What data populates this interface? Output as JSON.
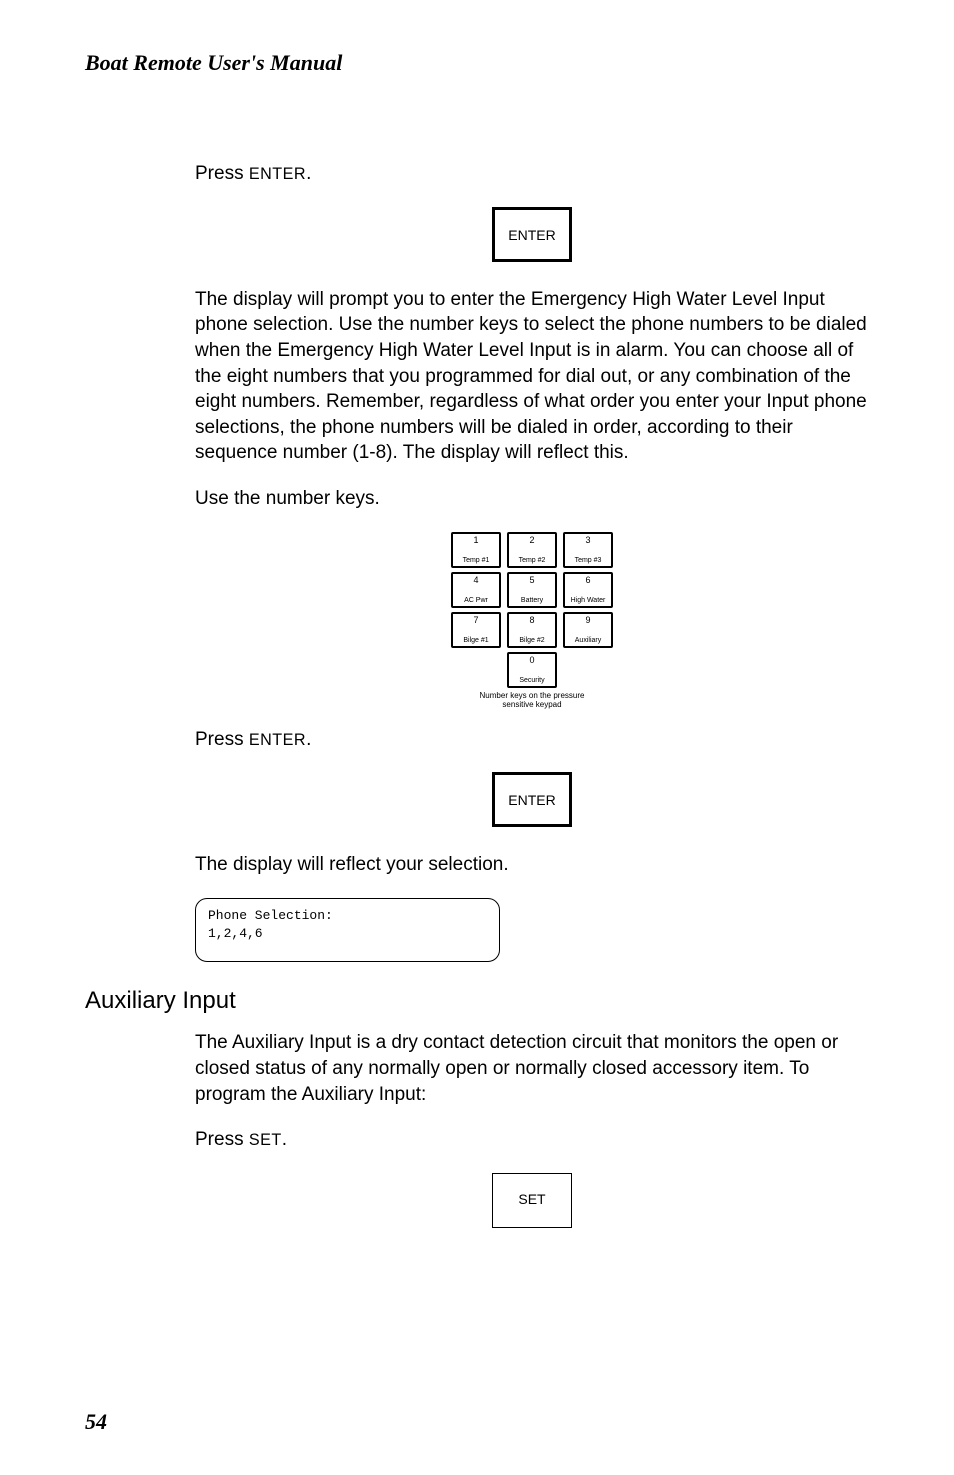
{
  "header": "Boat Remote User's Manual",
  "p1": "Press ",
  "p1_key": "ENTER",
  "p1_suffix": ".",
  "btn_enter": "ENTER",
  "p2": "The display will prompt you to enter the Emergency High Water Level Input phone selection. Use the number keys to select the phone numbers to be dialed when the Emergency High Water Level Input is in alarm. You can choose all of the eight numbers that you programmed for dial out, or any combination of the eight numbers. Remember, regardless of what order you enter your Input phone selections, the phone numbers will be dialed in order, according to their sequence number (1-8). The display will reflect this.",
  "p3": "Use the number keys.",
  "keypad": {
    "rows": [
      [
        {
          "num": "1",
          "lbl": "Temp #1"
        },
        {
          "num": "2",
          "lbl": "Temp #2"
        },
        {
          "num": "3",
          "lbl": "Temp #3"
        }
      ],
      [
        {
          "num": "4",
          "lbl": "AC Pwr"
        },
        {
          "num": "5",
          "lbl": "Battery"
        },
        {
          "num": "6",
          "lbl": "High\nWater"
        }
      ],
      [
        {
          "num": "7",
          "lbl": "Bilge #1"
        },
        {
          "num": "8",
          "lbl": "Bilge #2"
        },
        {
          "num": "9",
          "lbl": "Auxiliary"
        }
      ],
      [
        {
          "num": "0",
          "lbl": "Security"
        }
      ]
    ],
    "caption_line1": "Number keys on the pressure",
    "caption_line2": "sensitive keypad"
  },
  "p4": "Press ",
  "p4_key": "ENTER",
  "p4_suffix": ".",
  "p5": "The display will reflect your selection.",
  "lcd": {
    "line1": "Phone Selection:",
    "line2": "1,2,4,6"
  },
  "section_title": "Auxiliary Input",
  "p6": "The Auxiliary Input is a dry contact detection circuit that monitors the open or closed status of any normally open or normally closed accessory item. To program the Auxiliary Input:",
  "p7": "Press ",
  "p7_key": "SET",
  "p7_suffix": ".",
  "btn_set": "SET",
  "page_num": "54"
}
